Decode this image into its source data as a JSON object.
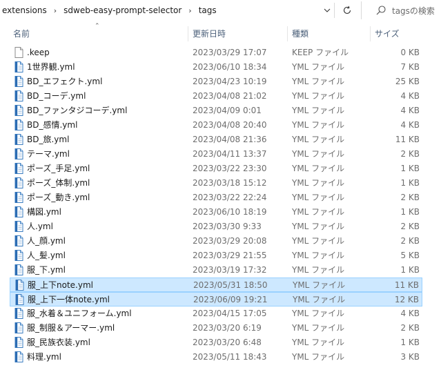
{
  "breadcrumb": [
    "extensions",
    "sdweb-easy-prompt-selector",
    "tags"
  ],
  "search": {
    "placeholder": "tagsの検索"
  },
  "columns": {
    "name": "名前",
    "date": "更新日時",
    "type": "種類",
    "size": "サイズ"
  },
  "files": [
    {
      "name": ".keep",
      "date": "2023/03/29 17:07",
      "type": "KEEP ファイル",
      "size": "0 KB",
      "icon": "blank-file-icon",
      "selected": false
    },
    {
      "name": "1世界観.yml",
      "date": "2023/06/10 18:34",
      "type": "YML ファイル",
      "size": "7 KB",
      "icon": "yml-file-icon",
      "selected": false
    },
    {
      "name": "BD_エフェクト.yml",
      "date": "2023/04/23 10:19",
      "type": "YML ファイル",
      "size": "25 KB",
      "icon": "yml-file-icon",
      "selected": false
    },
    {
      "name": "BD_コーデ.yml",
      "date": "2023/04/08 21:02",
      "type": "YML ファイル",
      "size": "4 KB",
      "icon": "yml-file-icon",
      "selected": false
    },
    {
      "name": "BD_ファンタジコーデ.yml",
      "date": "2023/04/09 0:01",
      "type": "YML ファイル",
      "size": "4 KB",
      "icon": "yml-file-icon",
      "selected": false
    },
    {
      "name": "BD_感情.yml",
      "date": "2023/04/08 20:40",
      "type": "YML ファイル",
      "size": "4 KB",
      "icon": "yml-file-icon",
      "selected": false
    },
    {
      "name": "BD_旅.yml",
      "date": "2023/04/08 21:36",
      "type": "YML ファイル",
      "size": "11 KB",
      "icon": "yml-file-icon",
      "selected": false
    },
    {
      "name": "テーマ.yml",
      "date": "2023/04/11 13:37",
      "type": "YML ファイル",
      "size": "2 KB",
      "icon": "yml-file-icon",
      "selected": false
    },
    {
      "name": "ポーズ_手足.yml",
      "date": "2023/03/22 23:30",
      "type": "YML ファイル",
      "size": "1 KB",
      "icon": "yml-file-icon",
      "selected": false
    },
    {
      "name": "ポーズ_体制.yml",
      "date": "2023/03/18 15:12",
      "type": "YML ファイル",
      "size": "1 KB",
      "icon": "yml-file-icon",
      "selected": false
    },
    {
      "name": "ポーズ_動き.yml",
      "date": "2023/03/22 22:24",
      "type": "YML ファイル",
      "size": "2 KB",
      "icon": "yml-file-icon",
      "selected": false
    },
    {
      "name": "構図.yml",
      "date": "2023/06/10 18:19",
      "type": "YML ファイル",
      "size": "1 KB",
      "icon": "yml-file-icon",
      "selected": false
    },
    {
      "name": "人.yml",
      "date": "2023/03/30 9:33",
      "type": "YML ファイル",
      "size": "2 KB",
      "icon": "yml-file-icon",
      "selected": false
    },
    {
      "name": "人_顔.yml",
      "date": "2023/03/29 20:08",
      "type": "YML ファイル",
      "size": "2 KB",
      "icon": "yml-file-icon",
      "selected": false
    },
    {
      "name": "人_髪.yml",
      "date": "2023/03/29 21:55",
      "type": "YML ファイル",
      "size": "5 KB",
      "icon": "yml-file-icon",
      "selected": false
    },
    {
      "name": "服_下.yml",
      "date": "2023/03/19 17:32",
      "type": "YML ファイル",
      "size": "1 KB",
      "icon": "yml-file-icon",
      "selected": false
    },
    {
      "name": "服_上下note.yml",
      "date": "2023/05/31 18:50",
      "type": "YML ファイル",
      "size": "11 KB",
      "icon": "yml-file-icon",
      "selected": true
    },
    {
      "name": "服_上下一体note.yml",
      "date": "2023/06/09 19:21",
      "type": "YML ファイル",
      "size": "12 KB",
      "icon": "yml-file-icon",
      "selected": true
    },
    {
      "name": "服_水着＆ユニフォーム.yml",
      "date": "2023/04/15 17:05",
      "type": "YML ファイル",
      "size": "4 KB",
      "icon": "yml-file-icon",
      "selected": false
    },
    {
      "name": "服_制服＆アーマー.yml",
      "date": "2023/03/20 6:19",
      "type": "YML ファイル",
      "size": "2 KB",
      "icon": "yml-file-icon",
      "selected": false
    },
    {
      "name": "服_民族衣装.yml",
      "date": "2023/03/20 6:48",
      "type": "YML ファイル",
      "size": "1 KB",
      "icon": "yml-file-icon",
      "selected": false
    },
    {
      "name": "料理.yml",
      "date": "2023/05/11 18:43",
      "type": "YML ファイル",
      "size": "3 KB",
      "icon": "yml-file-icon",
      "selected": false
    }
  ]
}
